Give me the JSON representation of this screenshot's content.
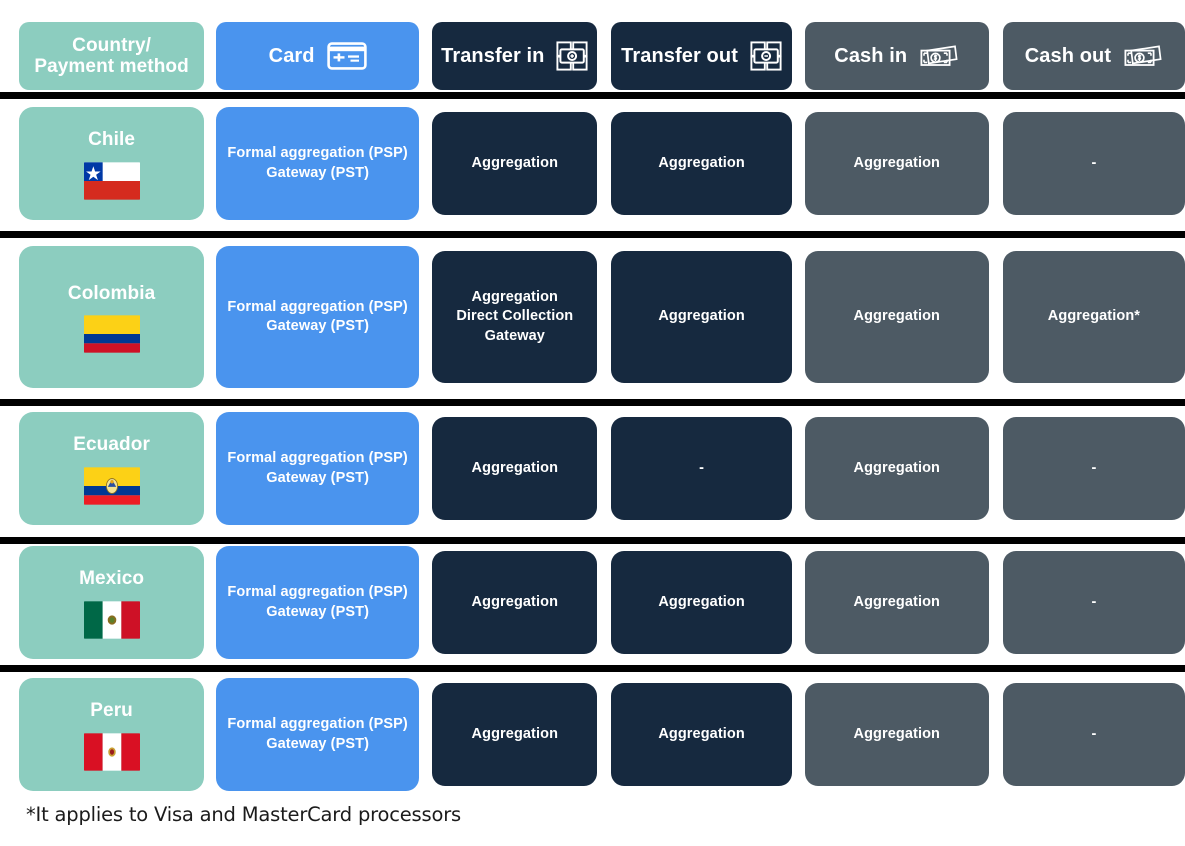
{
  "header": {
    "columns": [
      {
        "label": "Country/\nPayment method",
        "icon": "",
        "style": "green"
      },
      {
        "label": "Card",
        "icon": "credit-card-icon",
        "style": "blue"
      },
      {
        "label": "Transfer in",
        "icon": "transfer-in-icon",
        "style": "navy"
      },
      {
        "label": "Transfer out",
        "icon": "transfer-out-icon",
        "style": "navy"
      },
      {
        "label": "Cash in",
        "icon": "cash-in-icon",
        "style": "slate"
      },
      {
        "label": "Cash out",
        "icon": "cash-out-icon",
        "style": "slate"
      }
    ]
  },
  "rows": [
    {
      "country": "Chile",
      "flag": "chile-flag",
      "card": "Formal aggregation (PSP)\nGateway (PST)",
      "transfer_in": "Aggregation",
      "transfer_out": "Aggregation",
      "cash_in": "Aggregation",
      "cash_out": "-"
    },
    {
      "country": "Colombia",
      "flag": "colombia-flag",
      "card": "Formal aggregation (PSP)\nGateway (PST)",
      "transfer_in": "Aggregation\nDirect Collection\nGateway",
      "transfer_out": "Aggregation",
      "cash_in": "Aggregation",
      "cash_out": "Aggregation*"
    },
    {
      "country": "Ecuador",
      "flag": "ecuador-flag",
      "card": "Formal aggregation (PSP)\nGateway (PST)",
      "transfer_in": "Aggregation",
      "transfer_out": "-",
      "cash_in": "Aggregation",
      "cash_out": "-"
    },
    {
      "country": "Mexico",
      "flag": "mexico-flag",
      "card": "Formal aggregation (PSP)\nGateway (PST)",
      "transfer_in": "Aggregation",
      "transfer_out": "Aggregation",
      "cash_in": "Aggregation",
      "cash_out": "-"
    },
    {
      "country": "Peru",
      "flag": "peru-flag",
      "card": "Formal aggregation (PSP)\nGateway (PST)",
      "transfer_in": "Aggregation",
      "transfer_out": "Aggregation",
      "cash_in": "Aggregation",
      "cash_out": "-"
    }
  ],
  "footnote": "*It applies to Visa and MasterCard processors",
  "colors": {
    "country": "#8ccdbf",
    "card": "#4a94ee",
    "transfer": "#16293f",
    "cash": "#4d5a64",
    "divider": "#000000",
    "background": "#ffffff",
    "text_on_cell": "#ffffff",
    "footnote_text": "#1b1b1b"
  }
}
